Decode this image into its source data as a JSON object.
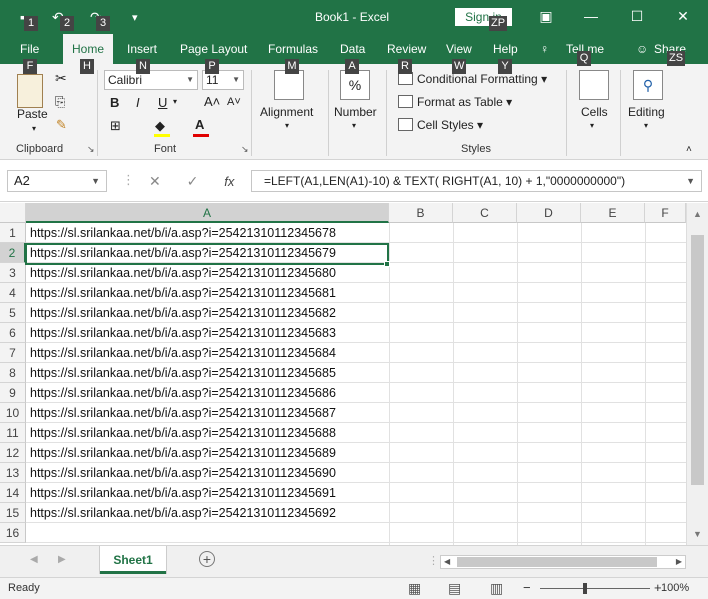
{
  "window": {
    "title": "Book1  -  Excel",
    "signin_label": "Sign in",
    "quick_access_keys": [
      "1",
      "2",
      "3"
    ],
    "zp_key": "ZP",
    "zs_key": "ZS"
  },
  "tabs": [
    {
      "label": "File",
      "key": "F"
    },
    {
      "label": "Home",
      "key": "H"
    },
    {
      "label": "Insert",
      "key": "N"
    },
    {
      "label": "Page Layout",
      "key": "P"
    },
    {
      "label": "Formulas",
      "key": "M"
    },
    {
      "label": "Data",
      "key": "A"
    },
    {
      "label": "Review",
      "key": "R"
    },
    {
      "label": "View",
      "key": "W"
    },
    {
      "label": "Help",
      "key": "Y"
    },
    {
      "label": "Tell me",
      "key": "Q"
    },
    {
      "label": "Share",
      "key": ""
    }
  ],
  "ribbon": {
    "clipboard": {
      "label": "Clipboard",
      "paste_label": "Paste"
    },
    "font": {
      "label": "Font",
      "font_name": "Calibri",
      "font_size": "11",
      "bold": "B",
      "italic": "I",
      "underline": "U"
    },
    "alignment": {
      "label": "Alignment"
    },
    "number": {
      "label": "Number",
      "symbol": "%"
    },
    "styles": {
      "label": "Styles",
      "conditional_formatting": "Conditional Formatting",
      "format_as_table": "Format as Table",
      "cell_styles": "Cell Styles"
    },
    "cells": {
      "label": "Cells"
    },
    "editing": {
      "label": "Editing"
    }
  },
  "formula_bar": {
    "name_box": "A2",
    "cancel_symbol": "✕",
    "enter_symbol": "✓",
    "fx_label": "fx",
    "formula": "=LEFT(A1,LEN(A1)-10) & TEXT( RIGHT(A1, 10) + 1,\"0000000000\")"
  },
  "grid": {
    "columns": [
      "A",
      "B",
      "C",
      "D",
      "E",
      "F"
    ],
    "rows": [
      "1",
      "2",
      "3",
      "4",
      "5",
      "6",
      "7",
      "8",
      "9",
      "10",
      "11",
      "12",
      "13",
      "14",
      "15",
      "16"
    ],
    "selected_cell": "A2",
    "cells": [
      "https://sl.srilankaa.net/b/i/a.asp?i=25421310112345678",
      "https://sl.srilankaa.net/b/i/a.asp?i=25421310112345679",
      "https://sl.srilankaa.net/b/i/a.asp?i=25421310112345680",
      "https://sl.srilankaa.net/b/i/a.asp?i=25421310112345681",
      "https://sl.srilankaa.net/b/i/a.asp?i=25421310112345682",
      "https://sl.srilankaa.net/b/i/a.asp?i=25421310112345683",
      "https://sl.srilankaa.net/b/i/a.asp?i=25421310112345684",
      "https://sl.srilankaa.net/b/i/a.asp?i=25421310112345685",
      "https://sl.srilankaa.net/b/i/a.asp?i=25421310112345686",
      "https://sl.srilankaa.net/b/i/a.asp?i=25421310112345687",
      "https://sl.srilankaa.net/b/i/a.asp?i=25421310112345688",
      "https://sl.srilankaa.net/b/i/a.asp?i=25421310112345689",
      "https://sl.srilankaa.net/b/i/a.asp?i=25421310112345690",
      "https://sl.srilankaa.net/b/i/a.asp?i=25421310112345691",
      "https://sl.srilankaa.net/b/i/a.asp?i=25421310112345692"
    ]
  },
  "sheets": {
    "active": "Sheet1",
    "add_symbol": "+"
  },
  "status": {
    "text": "Ready",
    "zoom": "100%",
    "zoom_minus": "−",
    "zoom_plus": "+"
  },
  "colors": {
    "accent": "#217346"
  }
}
